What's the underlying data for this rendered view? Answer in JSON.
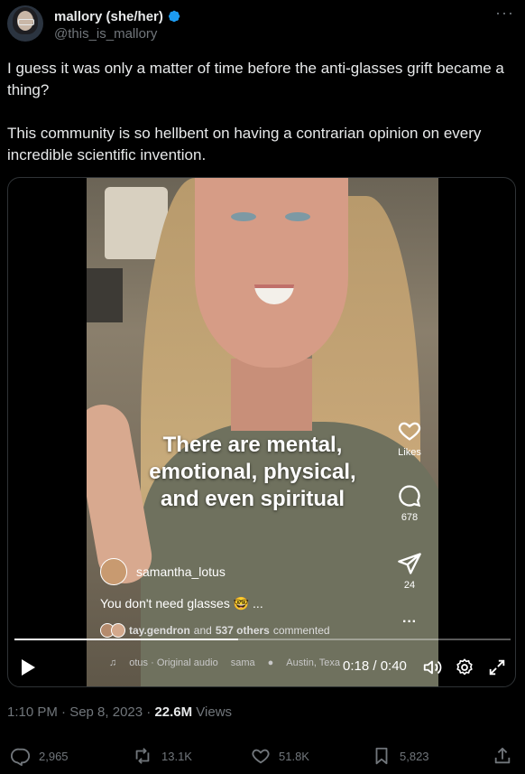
{
  "tweet": {
    "display_name": "mallory (she/her)",
    "handle": "@this_is_mallory",
    "more_glyph": "···",
    "text": "I guess it was only a matter of time before the anti-glasses grift became a thing?\n\nThis community is so hellbent on having a contrarian opinion on every incredible scientific invention.",
    "timestamp": "1:10 PM · Sep 8, 2023 · ",
    "views_count": "22.6M",
    "views_label": " Views"
  },
  "video": {
    "caption": "There are mental,\nemotional, physical,\nand even spiritual",
    "likes_label": "Likes",
    "comments_count": "678",
    "shares_count": "24",
    "more_glyph": "···",
    "username": "samantha_lotus",
    "description": "You don't need glasses 🤓 ...",
    "commenters_name": "tay.gendron",
    "commenters_mid": " and ",
    "commenters_count": "537 others",
    "commenters_suffix": " commented",
    "audio_text": "otus · Original audio",
    "audio_user": "sama",
    "location": "Austin, Texa",
    "time": "0:18 / 0:40",
    "progress_fraction": 0.45
  },
  "actions": {
    "replies": "2,965",
    "reposts": "13.1K",
    "likes": "51.8K",
    "bookmarks": "5,823"
  },
  "colors": {
    "verified": "#1d9bf0",
    "muted": "#71767b",
    "text": "#e7e9ea"
  }
}
